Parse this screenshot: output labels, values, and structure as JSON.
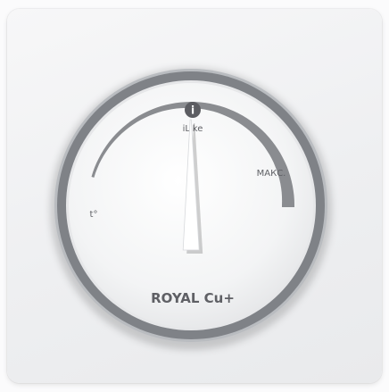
{
  "thermostat": {
    "brand_label": "ROYAL Cu+",
    "mode_label": "iLike",
    "max_label": "МАКС.",
    "temp_label": "t°",
    "info_icon_glyph": "i"
  },
  "setting": {
    "pointer_level": 0.45
  },
  "colors": {
    "ring": "#7f8287",
    "scale": "#8a8c90",
    "pointer": "#ffffff",
    "text": "#5f6065"
  }
}
